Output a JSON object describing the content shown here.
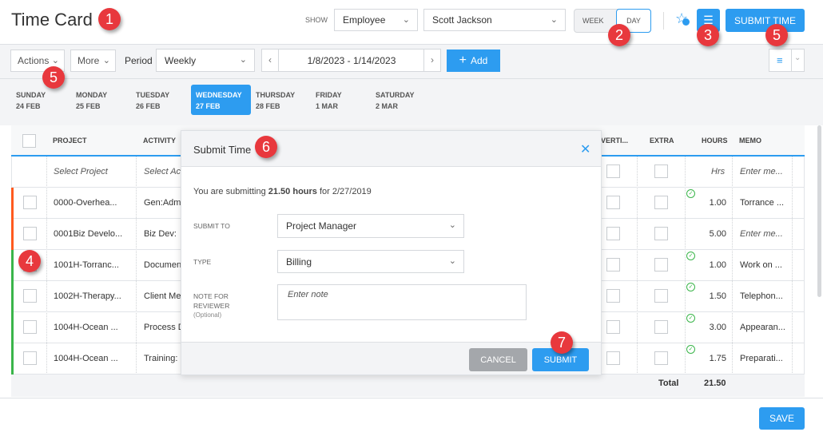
{
  "header": {
    "title": "Time Card",
    "show_label": "SHOW",
    "show_select": "Employee",
    "employee_select": "Scott Jackson",
    "week_label": "WEEK",
    "day_label": "DAY",
    "submit_time": "SUBMIT TIME"
  },
  "toolbar": {
    "actions": "Actions",
    "more": "More",
    "period_label": "Period",
    "period_select": "Weekly",
    "date_range": "1/8/2023 - 1/14/2023",
    "add": "Add"
  },
  "days": [
    {
      "name": "SUNDAY",
      "date": "24 FEB"
    },
    {
      "name": "MONDAY",
      "date": "25 FEB"
    },
    {
      "name": "TUESDAY",
      "date": "26 FEB"
    },
    {
      "name": "WEDNESDAY",
      "date": "27 FEB",
      "active": true
    },
    {
      "name": "THURSDAY",
      "date": "28 FEB"
    },
    {
      "name": "FRIDAY",
      "date": "1 MAR"
    },
    {
      "name": "SATURDAY",
      "date": "2 MAR"
    }
  ],
  "table": {
    "headers": {
      "project": "PROJECT",
      "activity": "ACTIVITY",
      "overtime": "VERTI...",
      "extra": "EXTRA",
      "hours": "HOURS",
      "memo": "MEMO"
    },
    "new_row": {
      "project": "Select Project",
      "activity": "Select Ac",
      "hours": "Hrs",
      "memo": "Enter me..."
    },
    "rows": [
      {
        "project": "0000-Overhea...",
        "activity": "Gen:Admi",
        "hours": "1.00",
        "memo": "Torrance ...",
        "status": "#ff5a1f",
        "approved": true
      },
      {
        "project": "0001Biz Develo...",
        "activity": "Biz Dev:",
        "hours": "5.00",
        "memo": "Enter me...",
        "status": "#ff5a1f",
        "approved": false
      },
      {
        "project": "1001H-Torranc...",
        "activity": "Documen",
        "hours": "1.00",
        "memo": "Work on ...",
        "status": "#3ab54a",
        "approved": true
      },
      {
        "project": "1002H-Therapy...",
        "activity": "Client Me",
        "hours": "1.50",
        "memo": "Telephon...",
        "status": "#3ab54a",
        "approved": true
      },
      {
        "project": "1004H-Ocean ...",
        "activity": "Process D",
        "hours": "3.00",
        "memo": "Appearan...",
        "status": "#3ab54a",
        "approved": true
      },
      {
        "project": "1004H-Ocean ...",
        "activity": "Training:",
        "hours": "1.75",
        "memo": "Preparati...",
        "status": "#3ab54a",
        "approved": true
      }
    ],
    "total_label": "Total",
    "total_value": "21.50"
  },
  "modal": {
    "title": "Submit Time",
    "summary_pre": "You are submitting ",
    "summary_hours": "21.50 hours",
    "summary_post": " for 2/27/2019",
    "submit_to_label": "SUBMIT TO",
    "submit_to_value": "Project Manager",
    "type_label": "TYPE",
    "type_value": "Billing",
    "note_label_1": "NOTE FOR",
    "note_label_2": "REVIEWER",
    "note_optional": "(Optional)",
    "note_placeholder": "Enter note",
    "cancel": "CANCEL",
    "submit": "SUBMIT"
  },
  "footer": {
    "save": "SAVE"
  },
  "annotations": [
    "1",
    "2",
    "3",
    "5",
    "5",
    "4",
    "6",
    "7"
  ]
}
